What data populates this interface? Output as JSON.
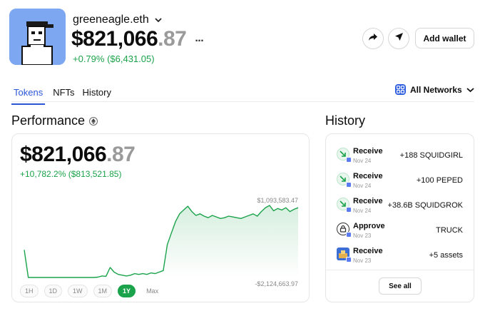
{
  "profile": {
    "name": "greeneagle.eth",
    "balance_main": "$821,066",
    "balance_cents": ".87",
    "more_label": "...",
    "change": "+0.79% ($6,431.05)",
    "avatar_bg": "#7da7f0"
  },
  "actions": {
    "add_wallet_label": "Add wallet",
    "share_icon": "share-icon",
    "send_icon": "send-icon"
  },
  "tabs": [
    {
      "label": "Tokens",
      "active": true
    },
    {
      "label": "NFTs",
      "active": false
    },
    {
      "label": "History",
      "active": false
    }
  ],
  "networks": {
    "label": "All Networks"
  },
  "performance": {
    "title": "Performance",
    "balance_main": "$821,066",
    "balance_cents": ".87",
    "change": "+10,782.2% ($813,521.85)",
    "ranges": [
      "1H",
      "1D",
      "1W",
      "1M",
      "1Y",
      "Max"
    ],
    "active_range": "1Y"
  },
  "chart_data": {
    "type": "area",
    "max_label": "$1,093,583.47",
    "min_label": "-$2,124,663.97",
    "color": "#1aa34a",
    "values": [
      380000,
      20000,
      20000,
      20000,
      20000,
      20000,
      20000,
      20000,
      20000,
      20000,
      20000,
      20000,
      20000,
      20000,
      20000,
      20000,
      20000,
      20000,
      25000,
      40000,
      35000,
      150000,
      90000,
      60000,
      50000,
      40000,
      50000,
      70000,
      60000,
      70000,
      60000,
      80000,
      70000,
      90000,
      110000,
      450000,
      600000,
      750000,
      850000,
      900000,
      950000,
      880000,
      830000,
      850000,
      820000,
      800000,
      830000,
      810000,
      790000,
      800000,
      820000,
      810000,
      800000,
      790000,
      810000,
      830000,
      850000,
      820000,
      880000,
      930000,
      960000,
      890000,
      920000,
      900000,
      930000,
      880000,
      910000,
      930000
    ]
  },
  "history": {
    "title": "History",
    "see_all_label": "See all",
    "items": [
      {
        "action": "Receive",
        "date": "Nov 24",
        "amount": "+188 SQUIDGIRL",
        "icon": "receive-icon"
      },
      {
        "action": "Receive",
        "date": "Nov 24",
        "amount": "+100 PEPED",
        "icon": "receive-icon"
      },
      {
        "action": "Receive",
        "date": "Nov 24",
        "amount": "+38.6B SQUIDGROK",
        "icon": "receive-icon"
      },
      {
        "action": "Approve",
        "date": "Nov 23",
        "amount": "TRUCK",
        "icon": "lock-icon"
      },
      {
        "action": "Receive",
        "date": "Nov 23",
        "amount": "+5 assets",
        "icon": "nft-thumbnail"
      }
    ]
  }
}
